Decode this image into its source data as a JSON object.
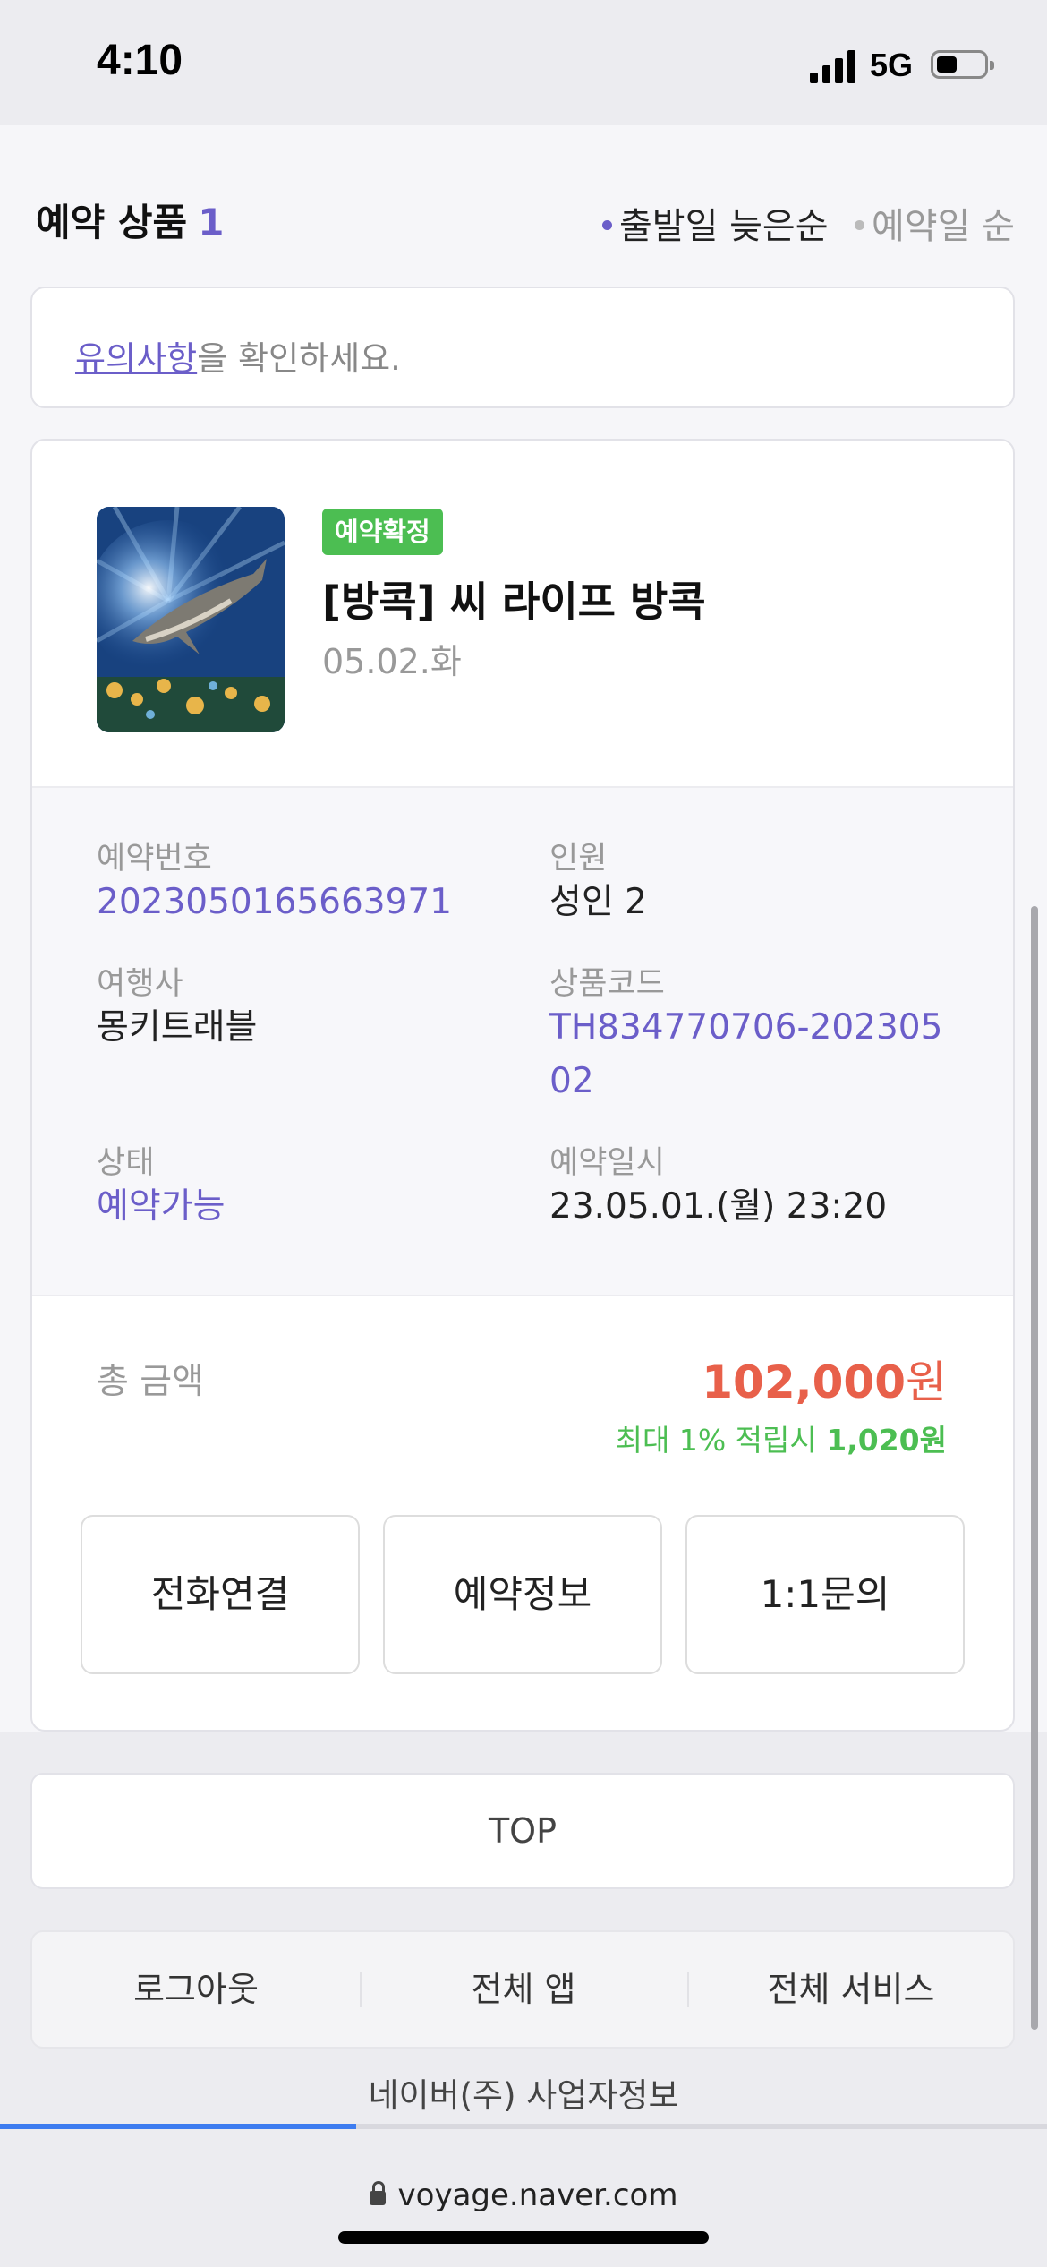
{
  "status_bar": {
    "time": "4:10",
    "network": "5G"
  },
  "header": {
    "title": "예약 상품",
    "count": "1"
  },
  "sort": {
    "late_departure": "출발일 늦은순",
    "booking_date": "예약일 순"
  },
  "notice": {
    "link": "유의사항",
    "text": "을 확인하세요."
  },
  "reservation": {
    "badge": "예약확정",
    "title": "[방콕] 씨 라이프 방콕",
    "date": "05.02.화",
    "details": {
      "booking_no_label": "예약번호",
      "booking_no": "2023050165663971",
      "people_label": "인원",
      "people": "성인 2",
      "agency_label": "여행사",
      "agency": "몽키트래블",
      "product_code_label": "상품코드",
      "product_code_line1": "TH834770706-202305",
      "product_code_line2": "02",
      "status_label": "상태",
      "status": "예약가능",
      "booked_at_label": "예약일시",
      "booked_at": "23.05.01.(월) 23:20"
    },
    "total_label": "총 금액",
    "total_amount": "102,000",
    "total_unit": "원",
    "points_prefix": "최대 1% 적립시 ",
    "points_amount": "1,020원",
    "actions": {
      "call": "전화연결",
      "info": "예약정보",
      "inquiry": "1:1문의"
    }
  },
  "footer": {
    "top": "TOP",
    "logout": "로그아웃",
    "all_apps": "전체 앱",
    "all_services": "전체 서비스",
    "biz_info": "네이버(주) 사업자정보"
  },
  "browser": {
    "url": "voyage.naver.com",
    "load_progress_pct": 34
  },
  "colors": {
    "accent": "#6b5ec9",
    "confirmed": "#4cbe52",
    "price": "#e8604a",
    "progress": "#3d7cf0"
  }
}
